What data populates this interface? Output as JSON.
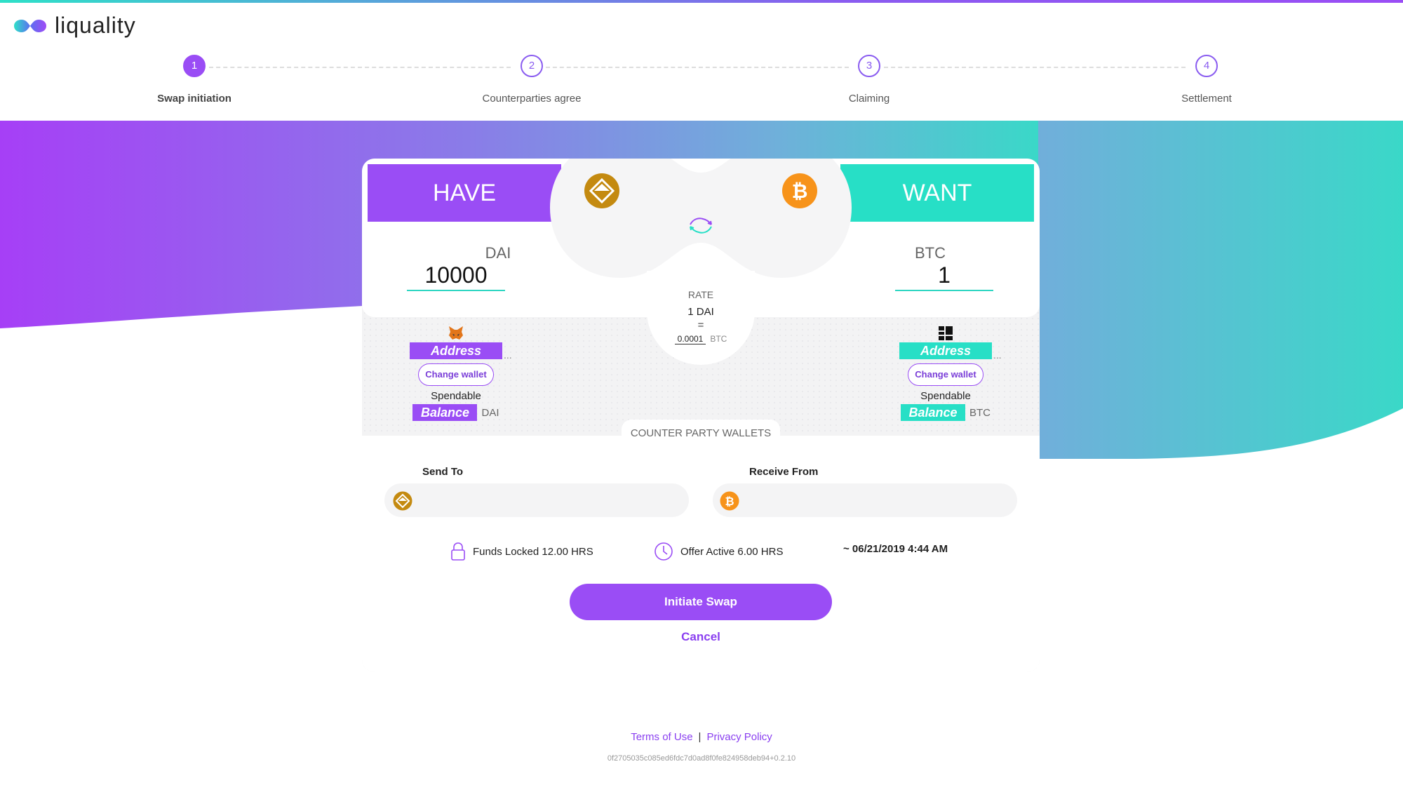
{
  "brand": {
    "name": "liquality"
  },
  "steps": [
    {
      "number": "1",
      "label": "Swap initiation"
    },
    {
      "number": "2",
      "label": "Counterparties agree"
    },
    {
      "number": "3",
      "label": "Claiming"
    },
    {
      "number": "4",
      "label": "Settlement"
    }
  ],
  "swap": {
    "have_label": "HAVE",
    "want_label": "WANT",
    "have": {
      "asset": "DAI",
      "amount": "10000",
      "address_label": "Address",
      "change_wallet": "Change wallet",
      "spendable": "Spendable",
      "balance_label": "Balance",
      "balance_unit": "DAI"
    },
    "want": {
      "asset": "BTC",
      "amount": "1",
      "address_label": "Address",
      "change_wallet": "Change wallet",
      "spendable": "Spendable",
      "balance_label": "Balance",
      "balance_unit": "BTC"
    },
    "ellipsis": "...",
    "rate": {
      "label": "RATE",
      "from": "1 DAI",
      "equals": "=",
      "value": "0.0001",
      "unit": "BTC"
    }
  },
  "counterparty": {
    "title": "COUNTER PARTY WALLETS",
    "send_to_label": "Send To",
    "receive_from_label": "Receive From",
    "send_to_value": "",
    "receive_from_value": ""
  },
  "terms": {
    "funds_locked": "Funds Locked 12.00 HRS",
    "offer_active": "Offer Active 6.00 HRS",
    "expiry": "~ 06/21/2019 4:44 AM"
  },
  "actions": {
    "initiate": "Initiate Swap",
    "cancel": "Cancel"
  },
  "footer": {
    "terms": "Terms of Use",
    "separator": "|",
    "privacy": "Privacy Policy",
    "version": "0f2705035c085ed6fdc7d0ad8f0fe824958deb94+0.2.10"
  },
  "colors": {
    "purple": "#9a4df5",
    "teal": "#27dfc6",
    "dai": "#c48a10",
    "btc": "#f7931a"
  },
  "icons": {
    "have_wallet": "metamask-fox-icon",
    "want_wallet": "ledger-icon",
    "have_coin": "dai-icon",
    "want_coin": "bitcoin-icon",
    "swap": "swap-arrows-icon",
    "lock": "lock-icon",
    "clock": "clock-icon"
  }
}
